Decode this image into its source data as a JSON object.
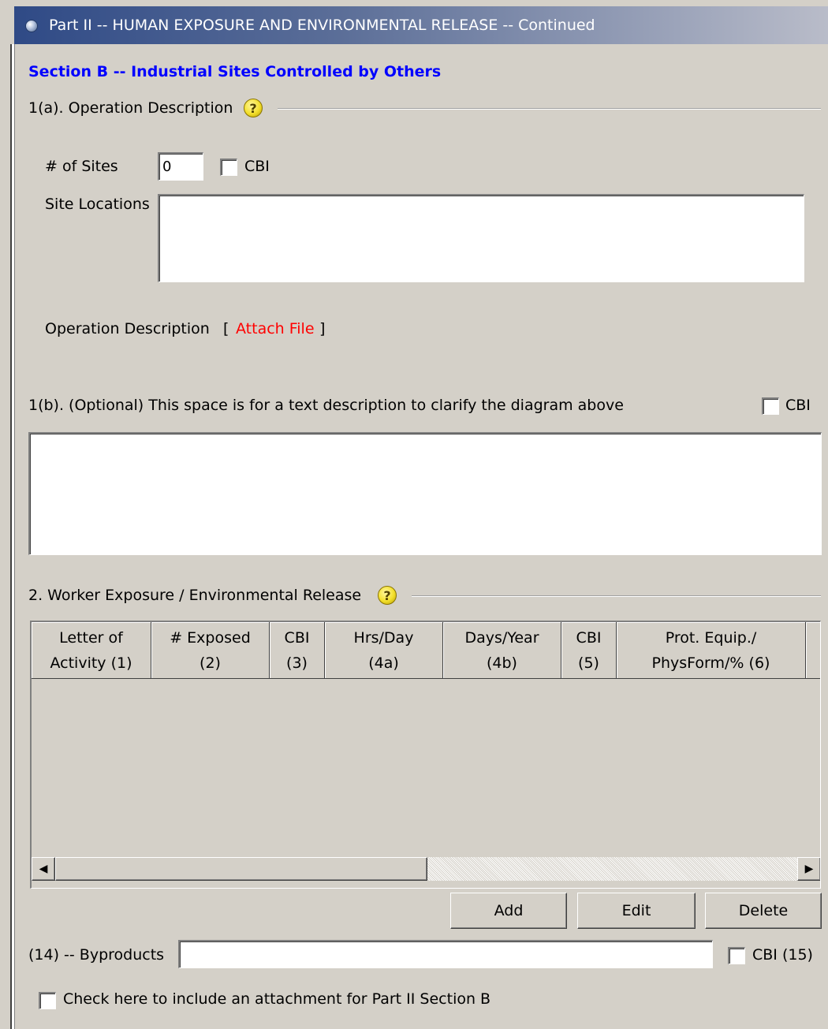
{
  "window": {
    "title": "Part II -- HUMAN EXPOSURE AND ENVIRONMENTAL RELEASE -- Continued",
    "icon": "globe-icon"
  },
  "section": {
    "title": "Section B -- Industrial Sites Controlled by Others"
  },
  "operation": {
    "heading": "1(a). Operation Description",
    "num_sites_label": "# of Sites",
    "num_sites_value": "0",
    "cbi_label": "CBI",
    "site_locations_label": "Site Locations",
    "site_locations_value": "",
    "description_label": "Operation Description",
    "bracket_open": "[",
    "attach_link": "Attach File",
    "bracket_close": "]"
  },
  "clarify": {
    "label": "1(b). (Optional) This space is for a text description to clarify the diagram above",
    "cbi_label": "CBI",
    "value": ""
  },
  "exposure": {
    "heading": "2. Worker Exposure / Environmental Release",
    "columns": [
      {
        "line1": "Letter of",
        "line2": "Activity (1)"
      },
      {
        "line1": "# Exposed",
        "line2": "(2)"
      },
      {
        "line1": "CBI",
        "line2": "(3)"
      },
      {
        "line1": "Hrs/Day",
        "line2": "(4a)"
      },
      {
        "line1": "Days/Year",
        "line2": "(4b)"
      },
      {
        "line1": "CBI",
        "line2": "(5)"
      },
      {
        "line1": "Prot. Equip./",
        "line2": "PhysForm/% (6)"
      }
    ],
    "rows": [],
    "scroll_left_glyph": "◀",
    "scroll_right_glyph": "▶",
    "add_label": "Add",
    "edit_label": "Edit",
    "delete_label": "Delete"
  },
  "byproducts": {
    "label": "(14) -- Byproducts",
    "value": "",
    "cbi_label": "CBI (15)"
  },
  "attachment": {
    "label": "Check here to include an attachment for Part II Section B"
  },
  "colors": {
    "section_title": "#0000ff",
    "attach_link": "#ff0000",
    "titlebar_start": "#2f4a86",
    "background": "#d4d0c8"
  }
}
